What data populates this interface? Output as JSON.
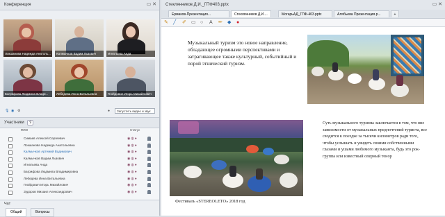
{
  "conference": {
    "title": "Конференция",
    "participants": [
      {
        "name": "Локшанова Надежда Анатоль..."
      },
      {
        "name": "Калмычков Вадим Львович"
      },
      {
        "name": "Игнатьева Анда"
      },
      {
        "name": "Багрифова Людмила Влади..."
      },
      {
        "name": "Лебедева Инна Витальевна"
      },
      {
        "name": "Гнойдовил Игорь Михайлович"
      }
    ],
    "video_button": "Запустить видео и звук"
  },
  "participants_panel": {
    "title": "Участники",
    "count": "9",
    "col_name": "ФИО",
    "col_status": "Статус",
    "rows": [
      {
        "name": "Симаев Алексей Сергеевич"
      },
      {
        "name": "Локшанова Надежда Анатольевна"
      },
      {
        "name": "Калмычков Артемий Вадимович"
      },
      {
        "name": "Калмычков Вадим Львович"
      },
      {
        "name": "Игнатьева Анда"
      },
      {
        "name": "Багрифова Людмила Владимировна"
      },
      {
        "name": "Лебедева Инна Витальевна"
      },
      {
        "name": "Гнойдовил Игорь Михайлович"
      },
      {
        "name": "Зудоров Михаил Александрович"
      }
    ]
  },
  "chat": {
    "title": "Чат",
    "tabs": [
      "Общий",
      "Вопросы"
    ]
  },
  "document": {
    "window_title": "Стеклянников Д.И._ГПФ403.pptx",
    "tabs": [
      {
        "label": "Ермаков-Презентация..."
      },
      {
        "label": "Стеклянников Д.И...."
      },
      {
        "label": "МогарьАД_ГПФ-403.pptx"
      },
      {
        "label": "Алябьева Презентация.р..."
      },
      {
        "label": "+"
      }
    ]
  },
  "slide": {
    "text_top": "Музыкальный туризм это новое направление, обладающее огромными перспективами и затрагивающее также культурный, событийный и порой этнический туризм.",
    "caption": "Фестиваль «STEREOLETO» 2018 год",
    "text_bottom": "Суть музыкального туризма заключается в том, что вне зависимости от музыкальных предпочтений туриста, все сводится к поездке за тысячи километров ради того, чтобы услышать и увидеть своими собственными глазами и ушами любимого музыканта, будь это рок-группа или известный оперный тенор"
  },
  "colors": {
    "accent": "#2a6fb5",
    "annotation_red": "#d21f2a"
  }
}
